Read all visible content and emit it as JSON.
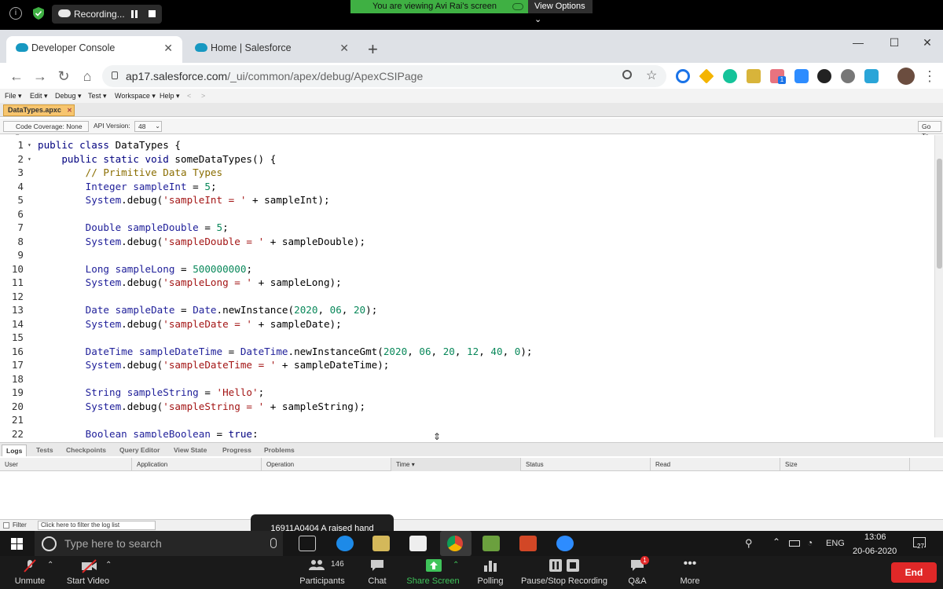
{
  "zoom_top": {
    "recording_label": "Recording...",
    "viewing_banner": "You are viewing Avi Rai's screen",
    "view_options": "View Options"
  },
  "browser": {
    "tabs": [
      {
        "title": "Developer Console"
      },
      {
        "title": "Home | Salesforce"
      }
    ],
    "url_host": "ap17.salesforce.com",
    "url_path": "/_ui/common/apex/debug/ApexCSIPage",
    "extension_badge": "1"
  },
  "dev_console": {
    "menus": [
      "File ▾",
      "Edit ▾",
      "Debug ▾",
      "Test ▾",
      "Workspace ▾",
      "Help ▾",
      "<",
      ">"
    ],
    "file_tab": "DataTypes.apxc",
    "code_coverage": "Code Coverage: None ▾",
    "api_version_label": "API Version:",
    "api_version_value": "48",
    "goto_label": "Go To",
    "code_lines": [
      {
        "n": "1",
        "fold": "▾",
        "html": "<span class=\"kw\">public class</span> DataTypes {"
      },
      {
        "n": "2",
        "fold": "▾",
        "html": "    <span class=\"kw\">public static void</span> someDataTypes() {"
      },
      {
        "n": "3",
        "fold": "",
        "html": "        <span class=\"cm\">// Primitive Data Types</span>"
      },
      {
        "n": "4",
        "fold": "",
        "html": "        <span class=\"ty\">Integer</span> <span class=\"ty\">sampleInt</span> = <span class=\"num\">5</span>;"
      },
      {
        "n": "5",
        "fold": "",
        "html": "        <span class=\"ty\">System</span>.debug(<span class=\"str\">'sampleInt = '</span> + sampleInt);"
      },
      {
        "n": "6",
        "fold": "",
        "html": ""
      },
      {
        "n": "7",
        "fold": "",
        "html": "        <span class=\"ty\">Double</span> <span class=\"ty\">sampleDouble</span> = <span class=\"num\">5</span>;"
      },
      {
        "n": "8",
        "fold": "",
        "html": "        <span class=\"ty\">System</span>.debug(<span class=\"str\">'sampleDouble = '</span> + sampleDouble);"
      },
      {
        "n": "9",
        "fold": "",
        "html": ""
      },
      {
        "n": "10",
        "fold": "",
        "html": "        <span class=\"ty\">Long</span> <span class=\"ty\">sampleLong</span> = <span class=\"num\">500000000</span>;"
      },
      {
        "n": "11",
        "fold": "",
        "html": "        <span class=\"ty\">System</span>.debug(<span class=\"str\">'sampleLong = '</span> + sampleLong);"
      },
      {
        "n": "12",
        "fold": "",
        "html": ""
      },
      {
        "n": "13",
        "fold": "",
        "html": "        <span class=\"ty\">Date</span> <span class=\"ty\">sampleDate</span> = <span class=\"ty\">Date</span>.newInstance(<span class=\"num\">2020</span>, <span class=\"num\">06</span>, <span class=\"num\">20</span>);"
      },
      {
        "n": "14",
        "fold": "",
        "html": "        <span class=\"ty\">System</span>.debug(<span class=\"str\">'sampleDate = '</span> + sampleDate);"
      },
      {
        "n": "15",
        "fold": "",
        "html": ""
      },
      {
        "n": "16",
        "fold": "",
        "html": "        <span class=\"ty\">DateTime</span> <span class=\"ty\">sampleDateTime</span> = <span class=\"ty\">DateTime</span>.newInstanceGmt(<span class=\"num\">2020</span>, <span class=\"num\">06</span>, <span class=\"num\">20</span>, <span class=\"num\">12</span>, <span class=\"num\">40</span>, <span class=\"num\">0</span>);"
      },
      {
        "n": "17",
        "fold": "",
        "html": "        <span class=\"ty\">System</span>.debug(<span class=\"str\">'sampleDateTime = '</span> + sampleDateTime);"
      },
      {
        "n": "18",
        "fold": "",
        "html": ""
      },
      {
        "n": "19",
        "fold": "",
        "html": "        <span class=\"ty\">String</span> <span class=\"ty\">sampleString</span> = <span class=\"str\">'Hello'</span>;"
      },
      {
        "n": "20",
        "fold": "",
        "html": "        <span class=\"ty\">System</span>.debug(<span class=\"str\">'sampleString = '</span> + sampleString);"
      },
      {
        "n": "21",
        "fold": "",
        "html": ""
      },
      {
        "n": "22",
        "fold": "",
        "html": "        <span class=\"ty\">Boolean</span> <span class=\"ty\">sampleBoolean</span> = <span class=\"kw\">true</span>;"
      }
    ],
    "bottom_tabs": [
      "Logs",
      "Tests",
      "Checkpoints",
      "Query Editor",
      "View State",
      "Progress",
      "Problems"
    ],
    "log_columns": [
      "User",
      "Application",
      "Operation",
      "Time ▾",
      "Status",
      "Read",
      "Size"
    ],
    "filter_label": "Filter",
    "filter_placeholder": "Click here to filter the log list"
  },
  "notification": "16911A0404 A raised hand",
  "taskbar": {
    "search_placeholder": "Type here to search",
    "lang": "ENG",
    "time": "13:06",
    "date": "20-06-2020",
    "notif_count": "27"
  },
  "zoom_controls": {
    "unmute": "Unmute",
    "start_video": "Start Video",
    "participants": "Participants",
    "participants_count": "146",
    "chat": "Chat",
    "share_screen": "Share Screen",
    "polling": "Polling",
    "pause_stop": "Pause/Stop Recording",
    "qa": "Q&A",
    "qa_badge": "1",
    "more": "More",
    "end": "End"
  }
}
